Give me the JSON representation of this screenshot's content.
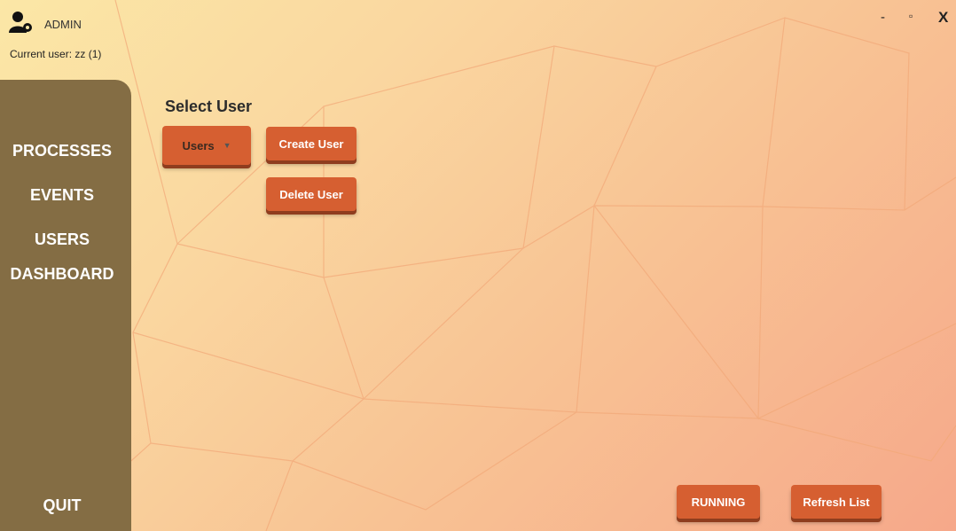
{
  "window": {
    "title": "ADMIN",
    "minimize": "-",
    "maximize": "▫",
    "close": "X"
  },
  "current_user": "Current user: zz (1)",
  "sidebar": {
    "items": [
      {
        "label": "PROCESSES"
      },
      {
        "label": "EVENTS"
      },
      {
        "label": "USERS"
      },
      {
        "label": "DASHBOARD"
      }
    ],
    "quit": "QUIT"
  },
  "main": {
    "section_title": "Select User",
    "user_dropdown": {
      "selected": "Users"
    },
    "create_label": "Create User",
    "delete_label": "Delete User"
  },
  "footer": {
    "running_label": "RUNNING",
    "refresh_label": "Refresh List"
  },
  "colors": {
    "accent": "#d65f31",
    "sidebar": "#846d44"
  },
  "icons": {
    "app": "user-gear-icon",
    "dropdown": "caret-down-icon"
  }
}
